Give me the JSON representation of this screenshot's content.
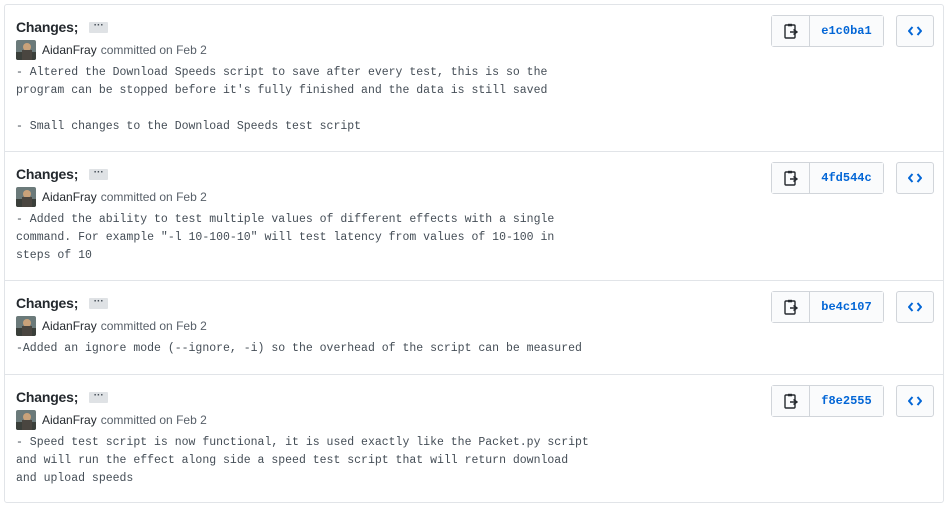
{
  "commits": [
    {
      "title": "Changes;",
      "ellipsis": "···",
      "author": "AidanFray",
      "committed": "committed on Feb 2",
      "description": "- Altered the Download Speeds script to save after every test, this is so the\nprogram can be stopped before it's fully finished and the data is still saved\n\n- Small changes to the Download Speeds test script",
      "sha": "e1c0ba1"
    },
    {
      "title": "Changes;",
      "ellipsis": "···",
      "author": "AidanFray",
      "committed": "committed on Feb 2",
      "description": "- Added the ability to test multiple values of different effects with a single\ncommand. For example \"-l 10-100-10\" will test latency from values of 10-100 in\nsteps of 10",
      "sha": "4fd544c"
    },
    {
      "title": "Changes;",
      "ellipsis": "···",
      "author": "AidanFray",
      "committed": "committed on Feb 2",
      "description": "-Added an ignore mode (--ignore, -i) so the overhead of the script can be measured",
      "sha": "be4c107"
    },
    {
      "title": "Changes;",
      "ellipsis": "···",
      "author": "AidanFray",
      "committed": "committed on Feb 2",
      "description": "- Speed test script is now functional, it is used exactly like the Packet.py script\nand will run the effect along side a speed test script that will return download\nand upload speeds",
      "sha": "f8e2555"
    }
  ],
  "icons": {
    "copy": "clipboard-icon",
    "browse": "code-icon"
  },
  "colors": {
    "link": "#0366d6",
    "border": "#e1e4e8"
  }
}
